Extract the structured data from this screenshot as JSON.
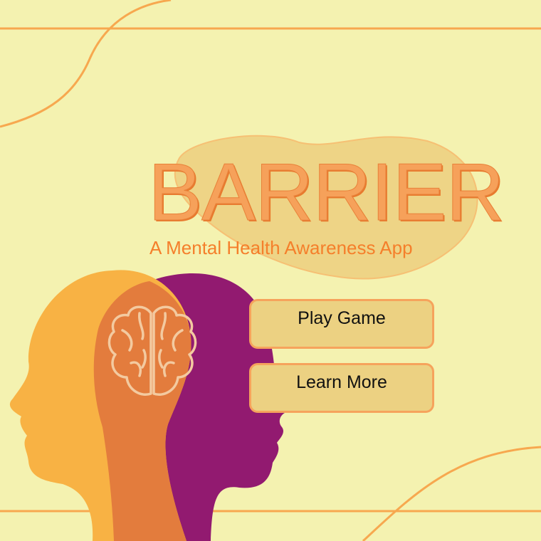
{
  "app": {
    "title": "BARRIER",
    "subtitle": "A Mental Health Awareness App"
  },
  "menu": {
    "play_label": "Play Game",
    "learn_label": "Learn More"
  },
  "colors": {
    "background": "#f4f2b0",
    "accent_orange": "#f6a15a",
    "subtitle_orange": "#f57f2b",
    "line_orange": "#f7a84f",
    "head_front": "#f8b244",
    "head_back": "#921a70",
    "head_overlap": "#e37c3d",
    "brain_outline": "#f3caa0",
    "button_fill": "#ecd182",
    "button_border": "#f6a35c",
    "blob_fill": "#eed486"
  },
  "illustration": {
    "icons": [
      "head-silhouette-front-icon",
      "head-silhouette-back-icon",
      "brain-icon"
    ]
  }
}
